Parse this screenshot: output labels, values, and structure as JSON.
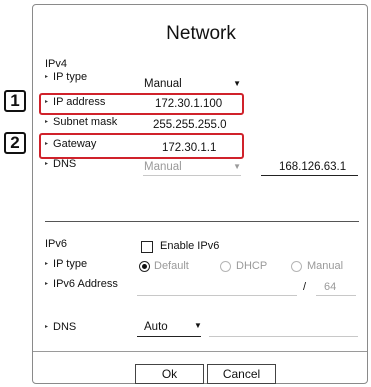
{
  "dialog": {
    "title": "Network"
  },
  "callouts": [
    "1",
    "2"
  ],
  "ipv4": {
    "section_label": "IPv4",
    "ip_type": {
      "label": "IP type",
      "value": "Manual"
    },
    "ip_address": {
      "label": "IP address",
      "value": "172.30.1.100"
    },
    "subnet_mask": {
      "label": "Subnet mask",
      "value": "255.255.255.0"
    },
    "gateway": {
      "label": "Gateway",
      "value": "172.30.1.1"
    },
    "dns": {
      "label": "DNS",
      "mode": "Manual",
      "value": "168.126.63.1"
    }
  },
  "ipv6": {
    "section_label": "IPv6",
    "enable_label": "Enable IPv6",
    "ip_type": {
      "label": "IP type",
      "options": [
        "Default",
        "DHCP",
        "Manual"
      ],
      "selected": "Default"
    },
    "ipv6_address": {
      "label": "IPv6 Address",
      "separator": "/",
      "prefix": "64"
    },
    "dns": {
      "label": "DNS",
      "value": "Auto"
    }
  },
  "buttons": {
    "ok": "Ok",
    "cancel": "Cancel"
  }
}
